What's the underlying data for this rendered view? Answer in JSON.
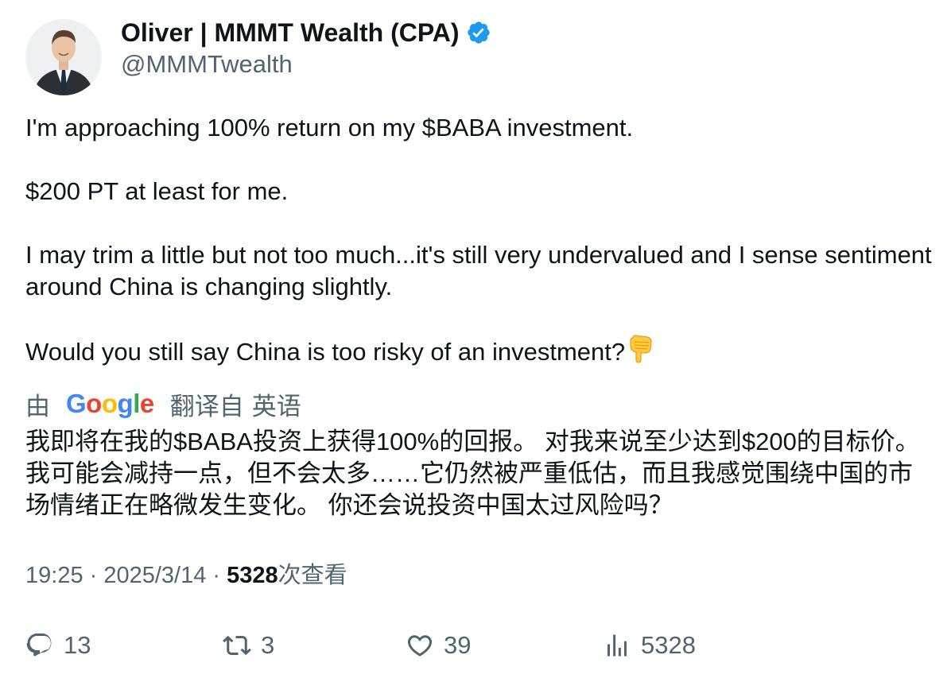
{
  "author": {
    "name": "Oliver | MMMT Wealth (CPA)",
    "handle": "@MMMTwealth",
    "verified_color": "#1d9bf0"
  },
  "tweet": {
    "paragraphs": [
      "I'm approaching 100% return on my $BABA investment.",
      "$200 PT at least for me.",
      "I may trim a little but not too much...it's still very undervalued and I sense sentiment around China is changing slightly.",
      "Would you still say China is too risky of an investment?"
    ],
    "emoji_icon": "backhand-index-pointing-down"
  },
  "translation": {
    "prefix": "由",
    "provider": "Google",
    "suffix": "翻译自",
    "language": "英语",
    "text": "我即将在我的$BABA投资上获得100%的回报。 对我来说至少达到$200的目标价。 我可能会减持一点，但不会太多……它仍然被严重低估，而且我感觉围绕中国的市场情绪正在略微发生变化。 你还会说投资中国太过风险吗？"
  },
  "meta": {
    "time": "19:25",
    "sep1": " · ",
    "date": "2025/3/14",
    "sep2": " · ",
    "views": "5328",
    "views_label": "次查看"
  },
  "actions": {
    "replies": "13",
    "retweets": "3",
    "likes": "39",
    "views": "5328"
  },
  "colors": {
    "text": "#0f1419",
    "secondary": "#536471",
    "google_blue": "#4285F4",
    "google_red": "#EA4335",
    "google_yellow": "#FBBC05",
    "google_green": "#34A853"
  }
}
